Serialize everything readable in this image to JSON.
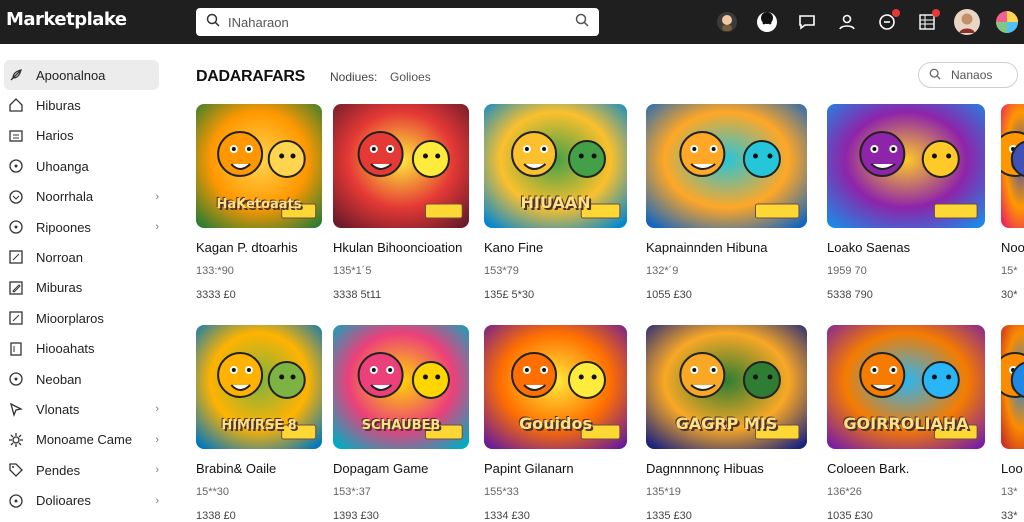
{
  "app": {
    "title": "Marketplake"
  },
  "search": {
    "placeholder": "INaharaon"
  },
  "topbar": {
    "icons": [
      "avatar-icon",
      "face-icon",
      "chat-icon",
      "user-icon",
      "notification-icon",
      "grid-icon",
      "profile-avatar",
      "color-wheel-icon"
    ]
  },
  "sidebar": {
    "items": [
      {
        "label": "Apoonalnoa",
        "icon": "feather-icon",
        "active": true,
        "chevron": false
      },
      {
        "label": "Hiburas",
        "icon": "home-icon",
        "active": false,
        "chevron": false
      },
      {
        "label": "Harios",
        "icon": "list-icon",
        "active": false,
        "chevron": false
      },
      {
        "label": "Uhoanga",
        "icon": "circle-icon",
        "active": false,
        "chevron": false
      },
      {
        "label": "Noorrhala",
        "icon": "chevron-circle-icon",
        "active": false,
        "chevron": true
      },
      {
        "label": "Ripoones",
        "icon": "circle-icon",
        "active": false,
        "chevron": true
      },
      {
        "label": "Norroan",
        "icon": "box-icon",
        "active": false,
        "chevron": false
      },
      {
        "label": "Miburas",
        "icon": "edit-icon",
        "active": false,
        "chevron": false
      },
      {
        "label": "Mioorplaros",
        "icon": "box-icon",
        "active": false,
        "chevron": false
      },
      {
        "label": "Hiooahats",
        "icon": "doc-icon",
        "active": false,
        "chevron": false
      },
      {
        "label": "Neoban",
        "icon": "circle-icon",
        "active": false,
        "chevron": false
      },
      {
        "label": "Vlonats",
        "icon": "cursor-icon",
        "active": false,
        "chevron": true
      },
      {
        "label": "Monoame Came",
        "icon": "gear-icon",
        "active": false,
        "chevron": true
      },
      {
        "label": "Pendes",
        "icon": "tag-icon",
        "active": false,
        "chevron": true
      },
      {
        "label": "Dolioares",
        "icon": "circle-icon",
        "active": false,
        "chevron": true
      }
    ]
  },
  "main": {
    "title": "DADARAFARS",
    "filter_label": "Nodiues:",
    "filter_value": "Golioes",
    "sort_placeholder": "Nanaos"
  },
  "cards": [
    {
      "title": "Kagan P. dtoarhis",
      "meta": "133:*90",
      "price": "3333 £0",
      "art": "HaKetoaats",
      "colors": [
        "#2e7d32",
        "#ff9800",
        "#ffd54f"
      ]
    },
    {
      "title": "Hkulan Bihooncioation",
      "meta": "135*1´5",
      "price": "3338 5t11",
      "art": "",
      "colors": [
        "#6a1b2a",
        "#e53935",
        "#ffeb3b"
      ]
    },
    {
      "title": "Kano Fine",
      "meta": "153*79",
      "price": "135£ 5*30",
      "art": "HIUAAN",
      "colors": [
        "#0288d1",
        "#fbc02d",
        "#43a047"
      ]
    },
    {
      "title": "Kapnainnden Hibuna",
      "meta": "132*´9",
      "price": "1055 £30",
      "art": "",
      "colors": [
        "#1565c0",
        "#ffa726",
        "#26c6da"
      ]
    },
    {
      "title": "Loako Saenas",
      "meta": "1959 70",
      "price": "5338 790",
      "art": "",
      "colors": [
        "#1e88e5",
        "#8e24aa",
        "#ffca28"
      ]
    },
    {
      "title": "Noo",
      "meta": "15*",
      "price": "30*",
      "art": "",
      "colors": [
        "#e91e63",
        "#ff9800",
        "#3f51b5"
      ]
    },
    {
      "title": "Brabin& Oaile",
      "meta": "15**30",
      "price": "1338 £0",
      "art": "HIMIRSE 8",
      "colors": [
        "#0277bd",
        "#ffb300",
        "#7cb342"
      ]
    },
    {
      "title": "Dopagam Game",
      "meta": "153*:37",
      "price": "1393 £30",
      "art": "SCHAUBEB",
      "colors": [
        "#00acc1",
        "#ec407a",
        "#ffd600"
      ]
    },
    {
      "title": "Papint Gilanarn",
      "meta": "155*33",
      "price": "1334 £30",
      "art": "Gouidos",
      "colors": [
        "#6a1b9a",
        "#ff6f00",
        "#ffeb3b"
      ]
    },
    {
      "title": "Dagnnnnonç Hibuas",
      "meta": "135*19",
      "price": "1335 £30",
      "art": "GAGRP MIS",
      "colors": [
        "#1a237e",
        "#f9a825",
        "#2e7d32"
      ]
    },
    {
      "title": "Coloeen Bark.",
      "meta": "136*26",
      "price": "1035 £30",
      "art": "GOIRROLIAHA",
      "colors": [
        "#7b1fa2",
        "#f57c00",
        "#29b6f6"
      ]
    },
    {
      "title": "Loo",
      "meta": "13*",
      "price": "33*",
      "art": "",
      "colors": [
        "#c62828",
        "#fb8c00",
        "#1e88e5"
      ]
    }
  ]
}
